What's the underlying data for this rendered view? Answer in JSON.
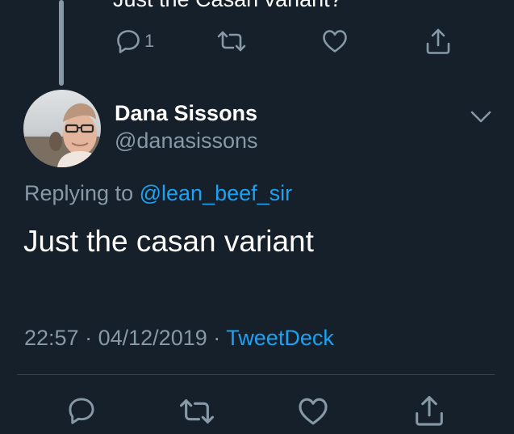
{
  "previous_tweet": {
    "text_tail": "Just the Casan variant?",
    "reply_count": "1"
  },
  "tweet": {
    "display_name": "Dana Sissons",
    "handle": "@danasissons",
    "replying_prefix": "Replying to",
    "replying_to": "@lean_beef_sir",
    "text": "Just the casan variant",
    "time": "22:57",
    "separator": "·",
    "date": "04/12/2019",
    "source": "TweetDeck"
  },
  "icons": {
    "reply": "reply-icon",
    "retweet": "retweet-icon",
    "like": "heart-icon",
    "share": "share-icon",
    "menu": "chevron-down-icon"
  },
  "colors": {
    "background": "#15202b",
    "secondary_text": "#8899a6",
    "link": "#1da1f2",
    "divider": "#38444d"
  }
}
